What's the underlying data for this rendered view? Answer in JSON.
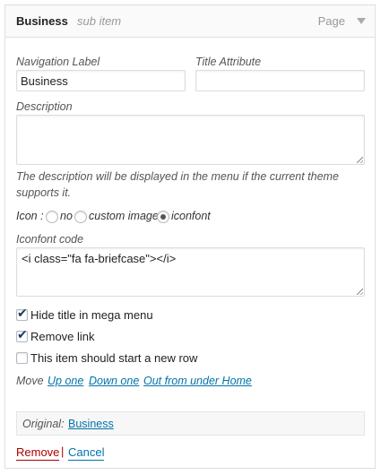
{
  "item_bar": {
    "title": "Business",
    "subtitle": "sub item",
    "type": "Page"
  },
  "fields": {
    "nav_label": {
      "label": "Navigation Label",
      "value": "Business"
    },
    "title_attr": {
      "label": "Title Attribute",
      "value": ""
    },
    "description": {
      "label": "Description",
      "value": "",
      "help": "The description will be displayed in the menu if the current theme supports it."
    },
    "icon": {
      "label": "Icon :",
      "options": [
        "no",
        "custom image",
        "iconfont"
      ],
      "selected": "iconfont"
    },
    "iconfont_code": {
      "label": "Iconfont code",
      "value": "<i class=\"fa fa-briefcase\"></i>"
    }
  },
  "checkboxes": [
    {
      "label": "Hide title in mega menu",
      "checked": true
    },
    {
      "label": "Remove link",
      "checked": true
    },
    {
      "label": "This item should start a new row",
      "checked": false
    }
  ],
  "move": {
    "label": "Move",
    "links": [
      "Up one",
      "Down one",
      "Out from under Home"
    ]
  },
  "original": {
    "label": "Original:",
    "link": "Business"
  },
  "actions": {
    "remove": "Remove",
    "separator": "|",
    "cancel": "Cancel"
  }
}
